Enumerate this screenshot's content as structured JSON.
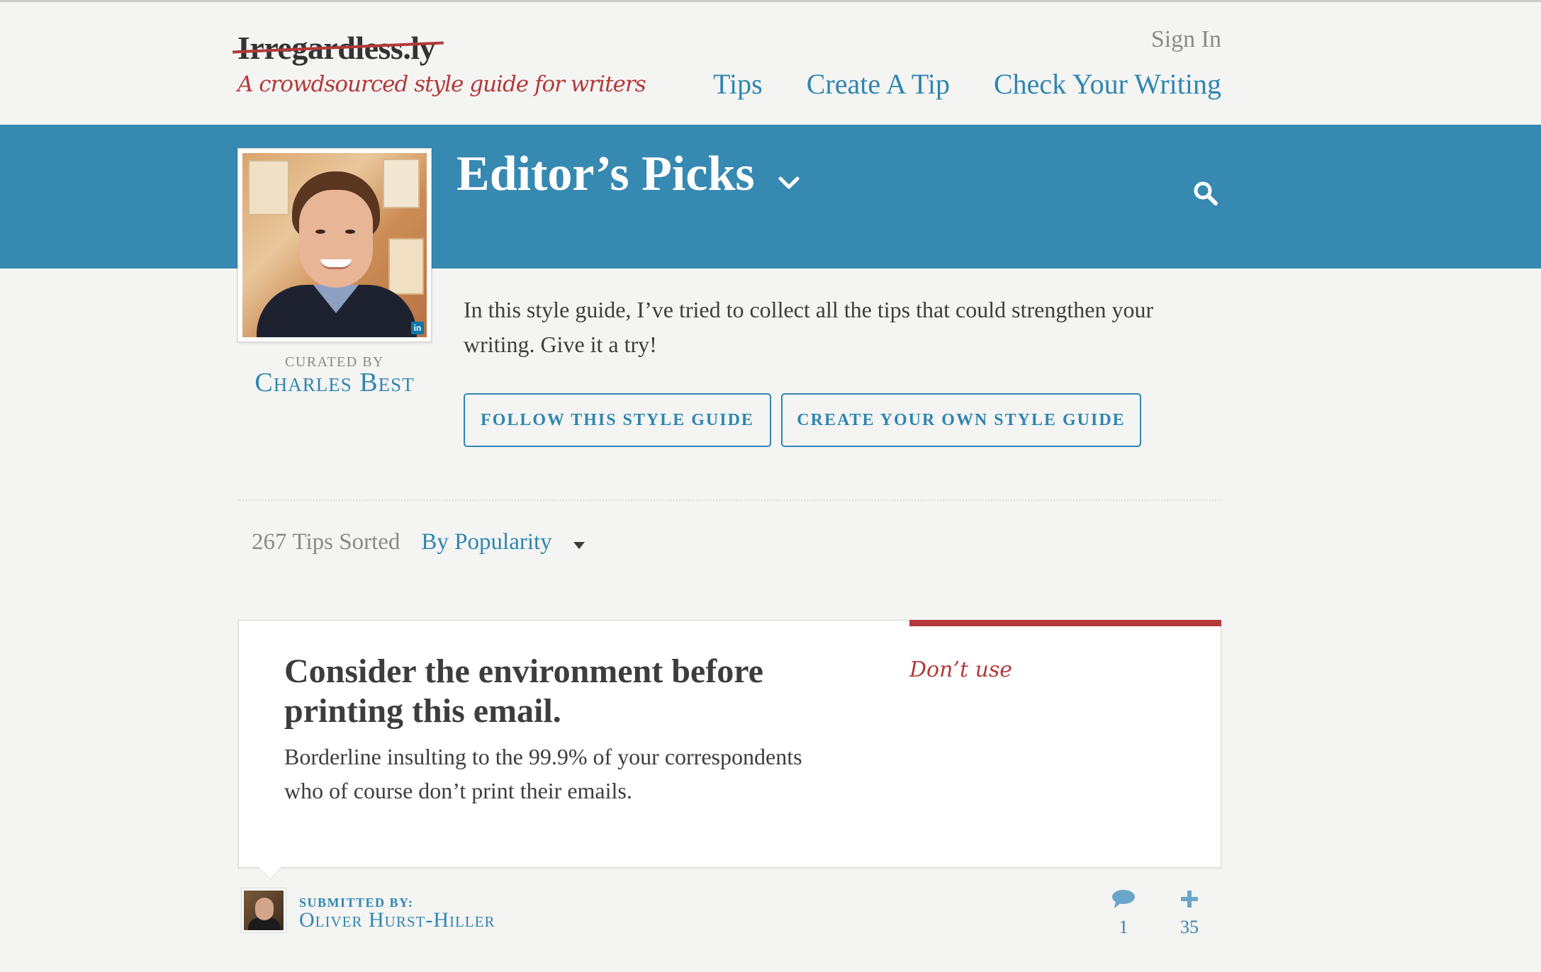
{
  "header": {
    "logo": "Irregardless.ly",
    "tagline": "A crowdsourced style guide for writers",
    "sign_in": "Sign In",
    "nav": [
      "Tips",
      "Create A Tip",
      "Check Your Writing"
    ]
  },
  "banner": {
    "title": "Editor’s Picks",
    "chevron_icon": "chevron-down-icon",
    "search_icon": "search-icon"
  },
  "curator": {
    "curated_by": "CURATED BY",
    "name": "Charles Best",
    "linkedin_badge": "in"
  },
  "intro": {
    "text": "In this style guide, I’ve tried to collect all the tips that could strengthen your writing. Give it a try!",
    "follow_button": "FOLLOW THIS STYLE GUIDE",
    "create_button": "CREATE YOUR OWN STYLE GUIDE"
  },
  "sort": {
    "count": "267",
    "sorted_label": "Tips Sorted",
    "selected": "By Popularity"
  },
  "tip": {
    "title": "Consider the environment before printing this email.",
    "body": "Borderline insulting to the 99.9% of your correspondents who of course don’t print their emails.",
    "tag": "Don’t use",
    "accent_color": "#b3393a",
    "submitted_label": "SUBMITTED BY:",
    "submitter": "Oliver Hurst-Hiller",
    "comments": "1",
    "votes": "35"
  },
  "colors": {
    "brand_blue": "#3689b1",
    "link_blue": "#2f86b0",
    "accent_red": "#b3393a",
    "background": "#f4f4f3"
  }
}
